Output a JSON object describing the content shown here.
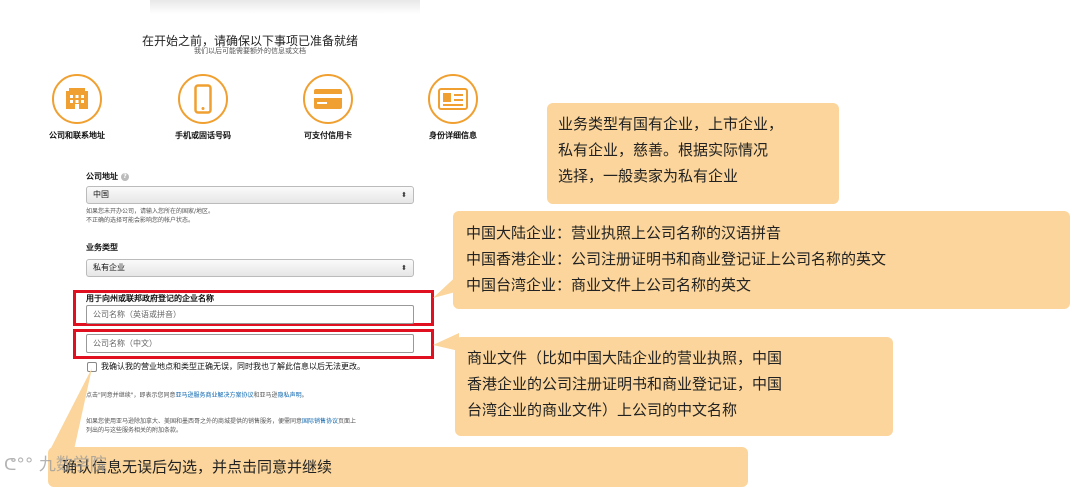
{
  "header": {
    "title": "在开始之前，请确保以下事项已准备就绪",
    "subtitle": "我们以后可能需要额外的信息或文档"
  },
  "requirements": [
    {
      "label": "公司和联系地址",
      "icon": "building-icon"
    },
    {
      "label": "手机或固话号码",
      "icon": "phone-icon"
    },
    {
      "label": "可支付信用卡",
      "icon": "credit-card-icon"
    },
    {
      "label": "身份详细信息",
      "icon": "id-card-icon"
    }
  ],
  "form": {
    "address_label": "公司地址",
    "address_help": "?",
    "address_value": "中国",
    "address_note_1": "如果您未开办公司，请输入您所在的国家/地区。",
    "address_note_2": "不正确的选择可能会影响您的帐户状态。",
    "business_type_label": "业务类型",
    "business_type_value": "私有企业",
    "company_name_label": "用于向州或联邦政府登记的企业名称",
    "company_name_placeholder": "公司名称（英语或拼音）",
    "company_name_cn_placeholder": "公司名称（中文）",
    "confirm_text": "我确认我的营业地点和类型正确无误，同时我也了解此信息以后无法更改。",
    "agree_prefix": "点击\"同意并继续\"，即表示您同意",
    "agree_link_1": "亚马逊服务商业解决方案协议",
    "agree_mid": "和亚马逊",
    "agree_link_2": "隐私声明",
    "agree_suffix": "。",
    "extra_prefix": "如果您使用亚马逊除加拿大、美国和墨西哥之外的商城提供的销售服务，便需同意",
    "extra_link": "国际销售协议",
    "extra_suffix_1": "页面上",
    "extra_suffix_2": "列出的与这些服务相关的附加条款。"
  },
  "callouts": {
    "business_type": [
      "业务类型有国有企业，上市企业，",
      "私有企业，慈善。根据实际情况",
      "选择，一般卖家为私有企业"
    ],
    "english_name": [
      {
        "prefix": "中国大陆企业：",
        "text": "营业执照上公司名称的汉语拼音"
      },
      {
        "prefix": "中国香港企业：",
        "text": "公司注册证明书和商业登记证上公司名称的英文"
      },
      {
        "prefix": "中国台湾企业：",
        "text": "商业文件上公司名称的英文"
      }
    ],
    "chinese_name": [
      "商业文件（比如中国大陆企业的营业执照，中国",
      "香港企业的公司注册证明书和商业登记证，中国",
      "台湾企业的商业文件）上公司的中文名称"
    ],
    "confirm": "确认信息无误后勾选，并点击同意并继续"
  },
  "watermark": "九数学院",
  "colors": {
    "accent": "#f0a030",
    "callout": "#fbd59b",
    "highlight": "#e01020",
    "link": "#0b66b0"
  }
}
